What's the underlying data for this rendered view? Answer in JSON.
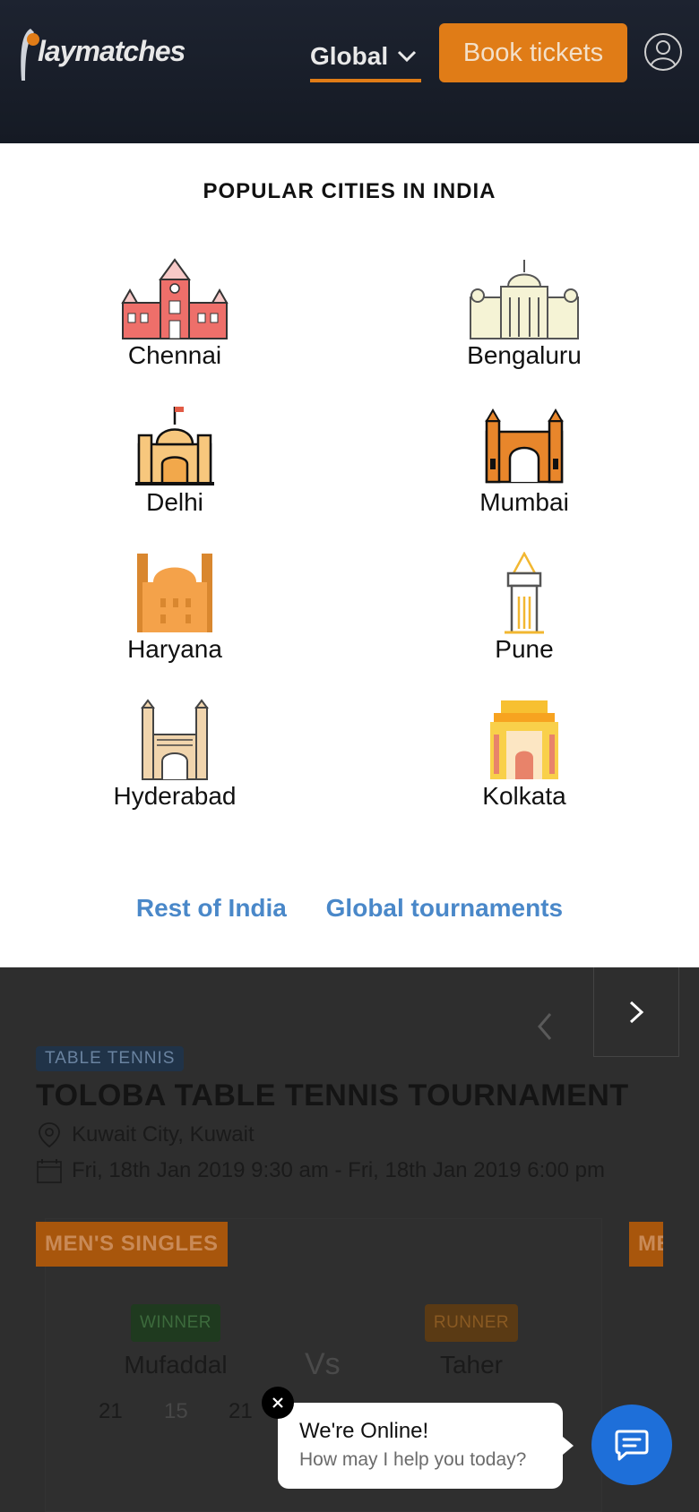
{
  "header": {
    "logo_text": "laymatches",
    "region_label": "Global",
    "book_button": "Book tickets"
  },
  "modal": {
    "title": "POPULAR CITIES IN INDIA",
    "cities": [
      {
        "name": "Chennai",
        "icon": "chennai-central-icon"
      },
      {
        "name": "Bengaluru",
        "icon": "vidhana-soudha-icon"
      },
      {
        "name": "Delhi",
        "icon": "jama-masjid-icon"
      },
      {
        "name": "Mumbai",
        "icon": "gateway-of-india-icon"
      },
      {
        "name": "Haryana",
        "icon": "haryana-monument-icon"
      },
      {
        "name": "Pune",
        "icon": "pune-tower-icon"
      },
      {
        "name": "Hyderabad",
        "icon": "charminar-icon"
      },
      {
        "name": "Kolkata",
        "icon": "india-gate-icon"
      }
    ],
    "links": {
      "rest_of_india": "Rest of India",
      "global_tournaments": "Global tournaments"
    }
  },
  "tournament": {
    "sport": "TABLE TENNIS",
    "title": "TOLOBA TABLE TENNIS TOURNAMENT",
    "location": "Kuwait City, Kuwait",
    "date": "Fri, 18th Jan 2019 9:30 am - Fri, 18th Jan 2019 6:00 pm",
    "category": "MEN'S SINGLES",
    "category_next": "ME",
    "winner_badge": "WINNER",
    "runner_badge": "RUNNER",
    "winner_name": "Mufaddal",
    "runner_name": "Taher",
    "vs": "Vs",
    "scores": [
      "21",
      "15",
      "21"
    ]
  },
  "chat": {
    "heading": "We're Online!",
    "subtext": "How may I help you today?"
  },
  "colors": {
    "accent_orange": "#e07c17",
    "link_blue": "#4a88c9",
    "chat_blue": "#1e6fd9"
  }
}
